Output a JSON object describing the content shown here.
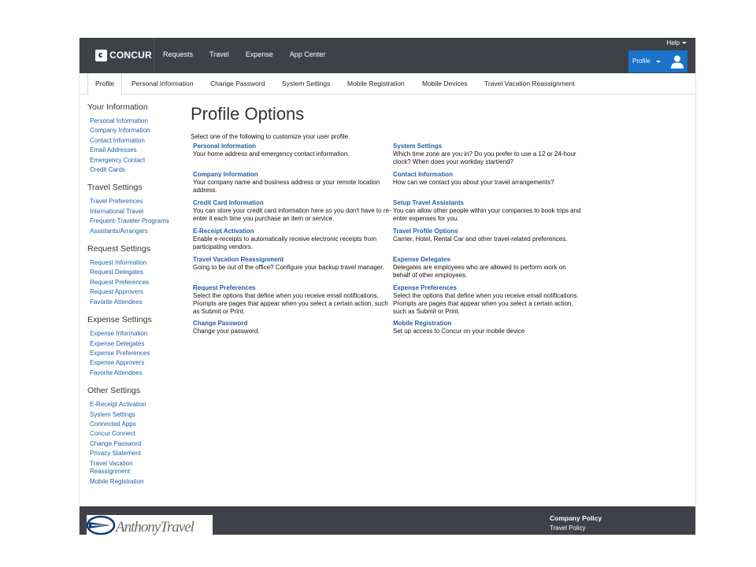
{
  "header": {
    "logo_text": "CONCUR",
    "nav": [
      "Requests",
      "Travel",
      "Expense",
      "App Center"
    ],
    "help_label": "Help",
    "profile_label": "Profile"
  },
  "subnav": {
    "tabs": [
      "Profile",
      "Personal Information",
      "Change Password",
      "System Settings",
      "Mobile Registration",
      "Mobile Devices",
      "Travel Vacation Reassignment"
    ]
  },
  "sidebar": {
    "sections": [
      {
        "heading": "Your Information",
        "items": [
          "Personal Information",
          "Company Information",
          "Contact Information",
          "Email Addresses",
          "Emergency Contact",
          "Credit Cards"
        ]
      },
      {
        "heading": "Travel Settings",
        "items": [
          "Travel Preferences",
          "International Travel",
          "Frequent-Traveler Programs",
          "Assistants/Arrangers"
        ]
      },
      {
        "heading": "Request Settings",
        "items": [
          "Request Information",
          "Request Delegates",
          "Request Preferences",
          "Request Approvers",
          "Favorite Attendees"
        ]
      },
      {
        "heading": "Expense Settings",
        "items": [
          "Expense Information",
          "Expense Delegates",
          "Expense Preferences",
          "Expense Approvers",
          "Favorite Attendees"
        ]
      },
      {
        "heading": "Other Settings",
        "items": [
          "E-Receipt Activation",
          "System Settings",
          "Connected Apps",
          "Concur Connect",
          "Change Password",
          "Privacy Statement",
          "Travel Vacation Reassignment",
          "Mobile Registration"
        ]
      }
    ]
  },
  "main": {
    "title": "Profile Options",
    "intro": "Select one of the following to customize your user profile.",
    "left_options": [
      {
        "title": "Personal Information",
        "desc": "Your home address and emergency contact information."
      },
      {
        "title": "Company Information",
        "desc": "Your company name and business address or your remote location address."
      },
      {
        "title": "Credit Card Information",
        "desc": "You can store your credit card information here so you don't have to re-enter it each time you purchase an item or service."
      },
      {
        "title": "E-Receipt Activation",
        "desc": "Enable e-receipts to automatically receive electronic receipts from participating vendors."
      },
      {
        "title": "Travel Vacation Reassignment",
        "desc": "Going to be out of the office? Configure your backup travel manager."
      },
      {
        "title": "Request Preferences",
        "desc": "Select the options that define when you receive email notifications. Prompts are pages that appear when you select a certain action, such as Submit or Print."
      },
      {
        "title": "Change Password",
        "desc": "Change your password."
      }
    ],
    "right_options": [
      {
        "title": "System Settings",
        "desc": "Which time zone are you in? Do you prefer to use a 12 or 24-hour clock? When does your workday start/end?"
      },
      {
        "title": "Contact Information",
        "desc": "How can we contact you about your travel arrangements?"
      },
      {
        "title": "Setup Travel Assistants",
        "desc": "You can allow other people within your companies to book trips and enter expenses for you."
      },
      {
        "title": "Travel Profile Options",
        "desc": "Carrier, Hotel, Rental Car and other travel-related preferences."
      },
      {
        "title": "Expense Delegates",
        "desc": "Delegates are employees who are allowed to perform work on behalf of other employees."
      },
      {
        "title": "Expense Preferences",
        "desc": "Select the options that define when you receive email notifications. Prompts are pages that appear when you select a certain action, such as Submit or Print."
      },
      {
        "title": "Mobile Registration",
        "desc": "Set up access to Concur on your mobile device"
      }
    ]
  },
  "footer": {
    "logo_text": "AnthonyTravel",
    "company_policy_heading": "Company Policy",
    "travel_policy_link": "Travel Policy"
  },
  "colors": {
    "topbar": "#3e4148",
    "link": "#1f5fa8",
    "profile_button": "#1a73c9"
  }
}
